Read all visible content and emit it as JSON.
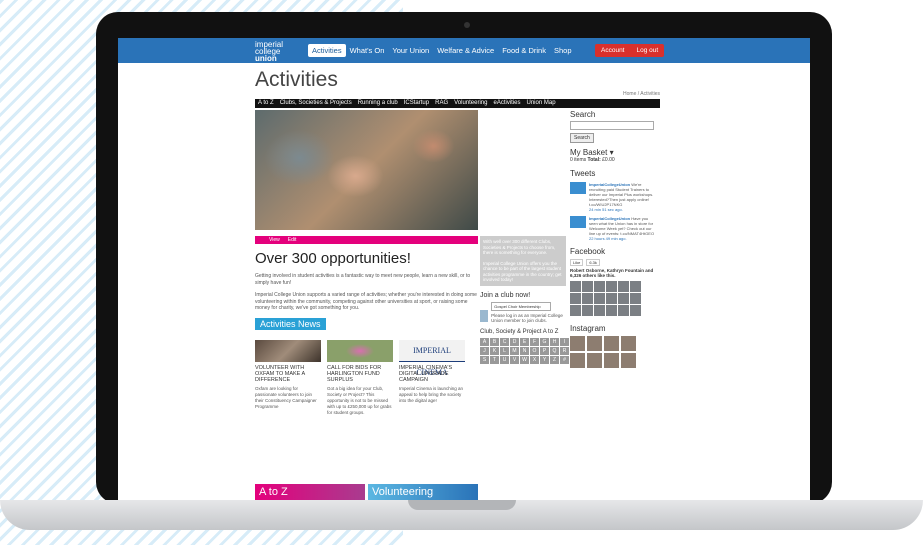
{
  "nav": {
    "logo": [
      "imperial",
      "college",
      "union"
    ],
    "items": [
      "Activities",
      "What's On",
      "Your Union",
      "Welfare & Advice",
      "Food & Drink",
      "Shop"
    ],
    "account": "Account",
    "logout": "Log out"
  },
  "page": {
    "title": "Activities",
    "breadcrumb": "Home / Activities"
  },
  "subnav": [
    "A to Z",
    "Clubs, Societies & Projects",
    "Running a club",
    "ICStartup",
    "RAG",
    "Volunteering",
    "eActivities",
    "Union Map"
  ],
  "main": {
    "tabs": [
      "View",
      "Edit"
    ],
    "headline": "Over 300 opportunities!",
    "intro": "Getting involved in student activities is a fantastic way to meet new people, learn a new skill, or to simply have fun!",
    "body": "Imperial College Union supports a varied range of activities; whether you're interested in doing some volunteering within the community, competing against other universities at sport, or raising some money for charity, we've got something for you.",
    "news_heading": "Activities News",
    "news": [
      {
        "title": "VOLUNTEER WITH OXFAM TO MAKE A DIFFERENCE",
        "text": "Oxfam are looking for passionate volunteers to join their Constituency Campaigner Programme",
        "color": "#6a5a50"
      },
      {
        "title": "CALL FOR BIDS FOR HARLINGTON FUND SURPLUS",
        "text": "Got a big idea for your Club, Society or Project? This opportunity is not to be missed with up to £250,000 up for grabs for student groups.",
        "color": "#8aa06a"
      },
      {
        "title": "IMPERIAL CINEMA'S DIGITAL UPGRADE CAMPAIGN",
        "text": "Imperial Cinema is launching an appeal to help bring the society into the digital age!",
        "color": "#e8e8e8",
        "banner": "IMPERIAL CINEMA"
      }
    ],
    "promos": [
      "A to Z",
      "Volunteering"
    ]
  },
  "mid": {
    "box1": "With well over 300 different Clubs, Societies & Projects to choose from, there is something for everyone.",
    "box2": "Imperial College Union offers you the chance to be part of the largest student activities programme in the country; get involved today!",
    "join_label": "Join a club now!",
    "select": "Gospel Choir Membership",
    "join_text": "Please log in as an Imperial College Union member to join clubs.",
    "az_label": "Club, Society & Project A to Z",
    "letters": [
      "A",
      "B",
      "C",
      "D",
      "E",
      "F",
      "G",
      "H",
      "I",
      "J",
      "K",
      "L",
      "M",
      "N",
      "O",
      "P",
      "Q",
      "R",
      "S",
      "T",
      "U",
      "V",
      "W",
      "X",
      "Y",
      "Z",
      "#"
    ]
  },
  "side": {
    "search_title": "Search",
    "search_btn": "Search",
    "basket_title": "My Basket",
    "basket_items": "0 items",
    "basket_total_label": "Total:",
    "basket_total": "£0.00",
    "tweets_title": "Tweets",
    "tweets": [
      {
        "handle": "ImperialCollegeUnion",
        "text": "We're recruiting paid Student Trainers to deliver our Imperial Plus workshops. Interested?Then just apply online! t.co/WIU2P17NKG",
        "time": "24 min 51 sec ago."
      },
      {
        "handle": "ImperialCollegeUnion",
        "text": "Have you seen what the Union has in store for Welcome Week yet? Check out our line up of events: t.co/NMAT4HtGEO",
        "time": "22 hours 49 min ago."
      }
    ],
    "fb_title": "Facebook",
    "fb_like": "Like",
    "fb_count": "6.3k",
    "fb_friends": "Robert Osborne, Kathryn Fountain and 6,326 others like this.",
    "insta_title": "Instagram"
  }
}
